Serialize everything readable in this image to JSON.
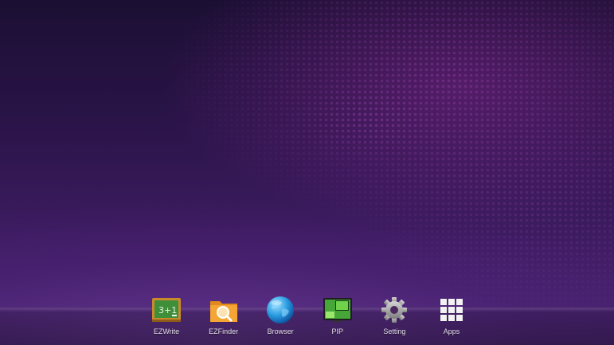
{
  "dock": {
    "items": [
      {
        "label": "EZWrite",
        "icon": "chalkboard-icon"
      },
      {
        "label": "EZFinder",
        "icon": "folder-search-icon"
      },
      {
        "label": "Browser",
        "icon": "globe-icon"
      },
      {
        "label": "PIP",
        "icon": "pip-window-icon"
      },
      {
        "label": "Setting",
        "icon": "gear-icon"
      },
      {
        "label": "Apps",
        "icon": "app-grid-icon"
      }
    ]
  },
  "icons": {
    "chalkboard_text": "3+1"
  },
  "colors": {
    "background_top": "#1b0f33",
    "background_bottom": "#4a2470",
    "accent_purple": "#7a3a9a",
    "label_text": "#e8e0ef"
  }
}
